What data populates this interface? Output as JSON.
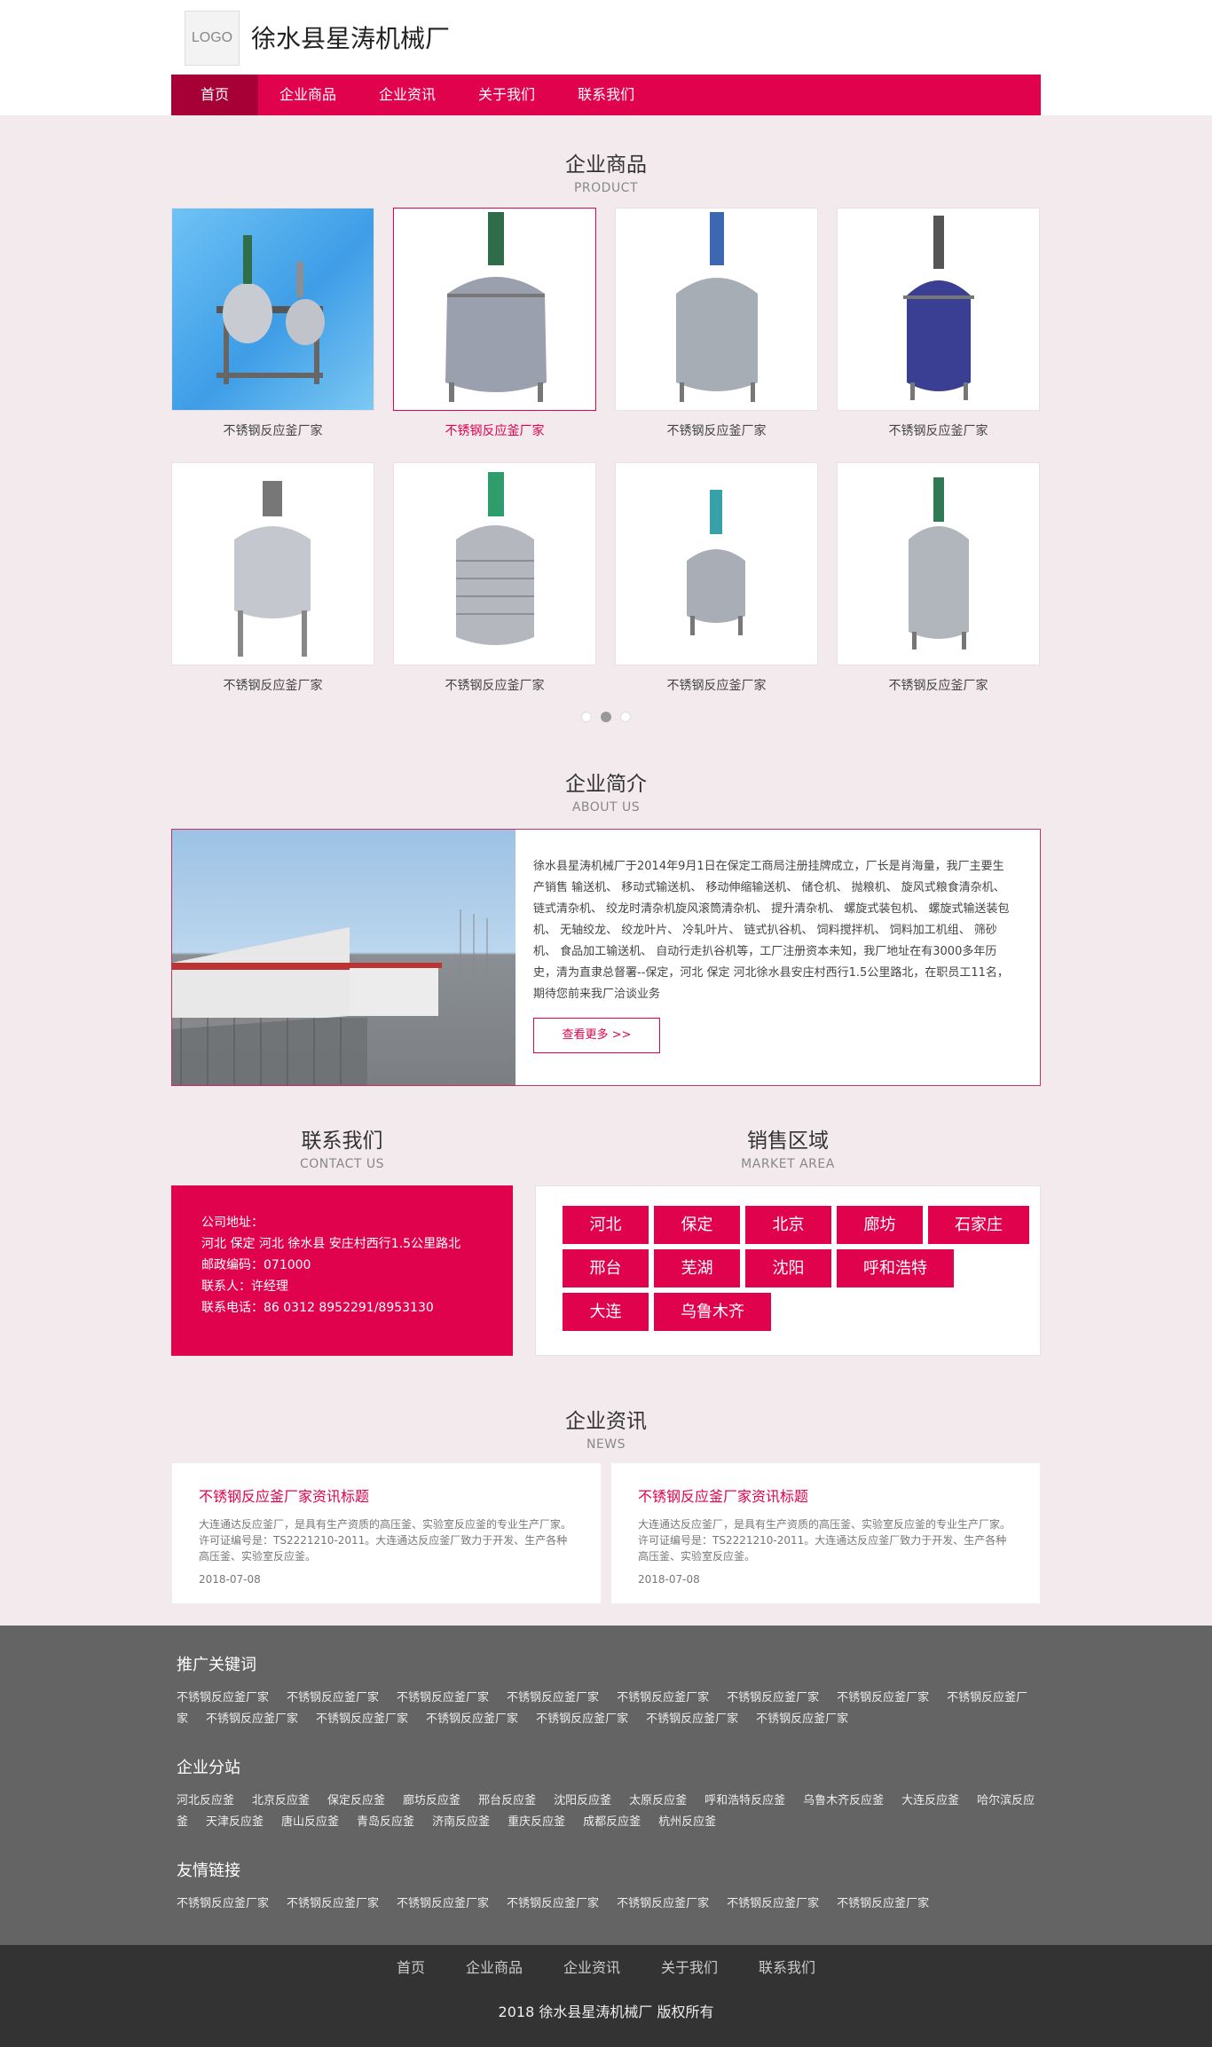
{
  "header": {
    "logo": "LOGO",
    "title": "徐水县星涛机械厂",
    "nav": [
      "首页",
      "企业商品",
      "企业资讯",
      "关于我们",
      "联系我们"
    ]
  },
  "products": {
    "title": "企业商品",
    "subtitle": "PRODUCT",
    "items": [
      {
        "caption": "不锈钢反应釜厂家"
      },
      {
        "caption": "不锈钢反应釜厂家"
      },
      {
        "caption": "不锈钢反应釜厂家"
      },
      {
        "caption": "不锈钢反应釜厂家"
      },
      {
        "caption": "不锈钢反应釜厂家"
      },
      {
        "caption": "不锈钢反应釜厂家"
      },
      {
        "caption": "不锈钢反应釜厂家"
      },
      {
        "caption": "不锈钢反应釜厂家"
      }
    ]
  },
  "about": {
    "title": "企业简介",
    "subtitle": "ABOUT US",
    "text": "徐水县星涛机械厂于2014年9月1日在保定工商局注册挂牌成立，厂长是肖海量，我厂主要生产销售 输送机、 移动式输送机、 移动伸缩输送机、 储仓机、 抛粮机、 旋风式粮食清杂机、 链式清杂机、 绞龙时清杂机旋风滚筒清杂机、 提升清杂机、 螺旋式装包机、 螺旋式输送装包机、 无轴绞龙、 绞龙叶片、 冷轧叶片、 链式扒谷机、 饲料搅拌机、 饲料加工机组、 筛砂机、 食品加工输送机、 自动行走扒谷机等，工厂注册资本未知，我厂地址在有3000多年历史，清为直隶总督署--保定，河北 保定 河北徐水县安庄村西行1.5公里路北，在职员工11名，期待您前来我厂洽谈业务",
    "more": "查看更多 >>"
  },
  "contact": {
    "title": "联系我们",
    "subtitle": "CONTACT US",
    "lines": [
      "公司地址：",
      "河北 保定 河北 徐水县 安庄村西行1.5公里路北",
      "邮政编码：071000",
      "联系人：许经理",
      "联系电话：86 0312 8952291/8953130"
    ]
  },
  "market": {
    "title": "销售区域",
    "subtitle": "MARKET AREA",
    "areas": [
      "河北",
      "保定",
      "北京",
      "廊坊",
      "石家庄",
      "邢台",
      "芜湖",
      "沈阳",
      "呼和浩特",
      "大连",
      "乌鲁木齐"
    ]
  },
  "news": {
    "title": "企业资讯",
    "subtitle": "NEWS",
    "items": [
      {
        "title": "不锈钢反应釜厂家资讯标题",
        "desc": "大连通达反应釜厂，是具有生产资质的高压釜、实验室反应釜的专业生产厂家。许可证编号是：TS2221210-2011。大连通达反应釜厂致力于开发、生产各种高压釜、实验室反应釜。",
        "date": "2018-07-08"
      },
      {
        "title": "不锈钢反应釜厂家资讯标题",
        "desc": "大连通达反应釜厂，是具有生产资质的高压釜、实验室反应釜的专业生产厂家。许可证编号是：TS2221210-2011。大连通达反应釜厂致力于开发、生产各种高压釜、实验室反应釜。",
        "date": "2018-07-08"
      }
    ]
  },
  "links": {
    "keywords_title": "推广关键词",
    "keywords": [
      "不锈钢反应釜厂家",
      "不锈钢反应釜厂家",
      "不锈钢反应釜厂家",
      "不锈钢反应釜厂家",
      "不锈钢反应釜厂家",
      "不锈钢反应釜厂家",
      "不锈钢反应釜厂家",
      "不锈钢反应釜厂家",
      "不锈钢反应釜厂家",
      "不锈钢反应釜厂家",
      "不锈钢反应釜厂家",
      "不锈钢反应釜厂家",
      "不锈钢反应釜厂家",
      "不锈钢反应釜厂家"
    ],
    "branches_title": "企业分站",
    "branches": [
      "河北反应釜",
      "北京反应釜",
      "保定反应釜",
      "廊坊反应釜",
      "邢台反应釜",
      "沈阳反应釜",
      "太原反应釜",
      "呼和浩特反应釜",
      "乌鲁木齐反应釜",
      "大连反应釜",
      "哈尔滨反应釜",
      "天津反应釜",
      "唐山反应釜",
      "青岛反应釜",
      "济南反应釜",
      "重庆反应釜",
      "成都反应釜",
      "杭州反应釜"
    ],
    "friends_title": "友情链接",
    "friends": [
      "不锈钢反应釜厂家",
      "不锈钢反应釜厂家",
      "不锈钢反应釜厂家",
      "不锈钢反应釜厂家",
      "不锈钢反应釜厂家",
      "不锈钢反应釜厂家",
      "不锈钢反应釜厂家"
    ]
  },
  "footer": {
    "nav": [
      "首页",
      "企业商品",
      "企业资讯",
      "关于我们",
      "联系我们"
    ],
    "copyright": "2018 徐水县星涛机械厂 版权所有"
  },
  "colors": {
    "accent": "#e0024c",
    "nav_active": "#a60036",
    "footer_gray": "#646464",
    "footer_dark": "#333333"
  }
}
